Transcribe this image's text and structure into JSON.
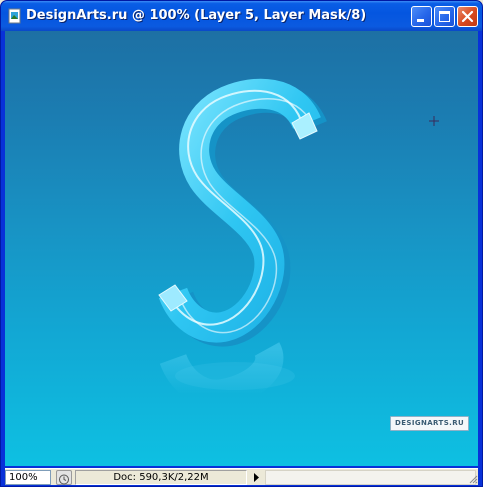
{
  "window": {
    "title": "DesignArts.ru @ 100% (Layer 5, Layer Mask/8)"
  },
  "canvas": {
    "watermark": "DESIGNARTS.RU",
    "glyph": "S",
    "colors": {
      "top": "#1d70a4",
      "bottom": "#0ec0e2",
      "glyph": "#3fd0f4"
    }
  },
  "statusbar": {
    "zoom": "100%",
    "doc_info": "Doc: 590,3K/2,22M"
  },
  "icons": {
    "app": "photoshop-document-icon",
    "minimize": "minimize-icon",
    "maximize": "maximize-icon",
    "close": "close-icon",
    "crosshair": "crosshair-cursor-icon",
    "status": "timer-icon",
    "menu": "play-arrow-icon"
  }
}
